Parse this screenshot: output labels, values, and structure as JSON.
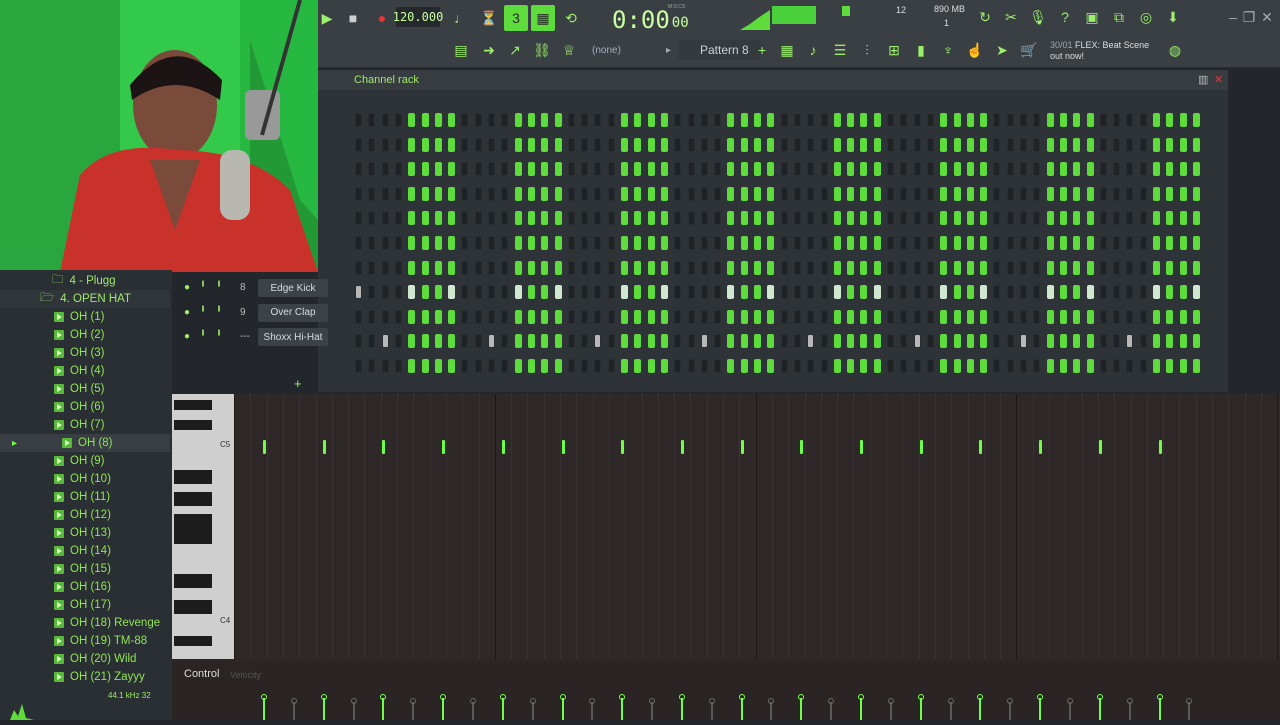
{
  "toolbar": {
    "tempo": "120.000",
    "time": "0:00",
    "time_sub": "00",
    "time_small": "M:S:CS",
    "pattern": "Pattern 8",
    "none_label": "(none)",
    "memory": "890 MB",
    "memory_sub": "1",
    "cpu": "12",
    "news_date": "30/01",
    "news_text": "FLEX: Beat Scene",
    "news_text2": "out now!"
  },
  "channel_rack": {
    "title": "Channel rack",
    "channels": [
      {
        "num": "8",
        "name": "Edge Kick"
      },
      {
        "num": "9",
        "name": "Over Clap"
      },
      {
        "num": "---",
        "name": "Shoxx Hi-Hat"
      }
    ],
    "add_symbol": "+"
  },
  "browser": {
    "items": [
      "4 - Plugg",
      "4. OPEN HAT",
      "OH (1)",
      "OH (2)",
      "OH (3)",
      "OH (4)",
      "OH (5)",
      "OH (6)",
      "OH (7)",
      "OH (8)",
      "OH (9)",
      "OH (10)",
      "OH (11)",
      "OH (12)",
      "OH (13)",
      "OH (14)",
      "OH (15)",
      "OH (16)",
      "OH (17)",
      "OH (18) Revenge",
      "OH (19) TM-88",
      "OH (20) Wild",
      "OH (21) Zayyy"
    ],
    "status": "44.1 kHz 32"
  },
  "piano_roll": {
    "key_labels": [
      "C5",
      "C4"
    ],
    "control_label": "Control",
    "velocity_label": "Velocity"
  },
  "colors": {
    "accent": "#6dff45",
    "panel": "#2e3338",
    "toolbar": "#3a3f44"
  }
}
